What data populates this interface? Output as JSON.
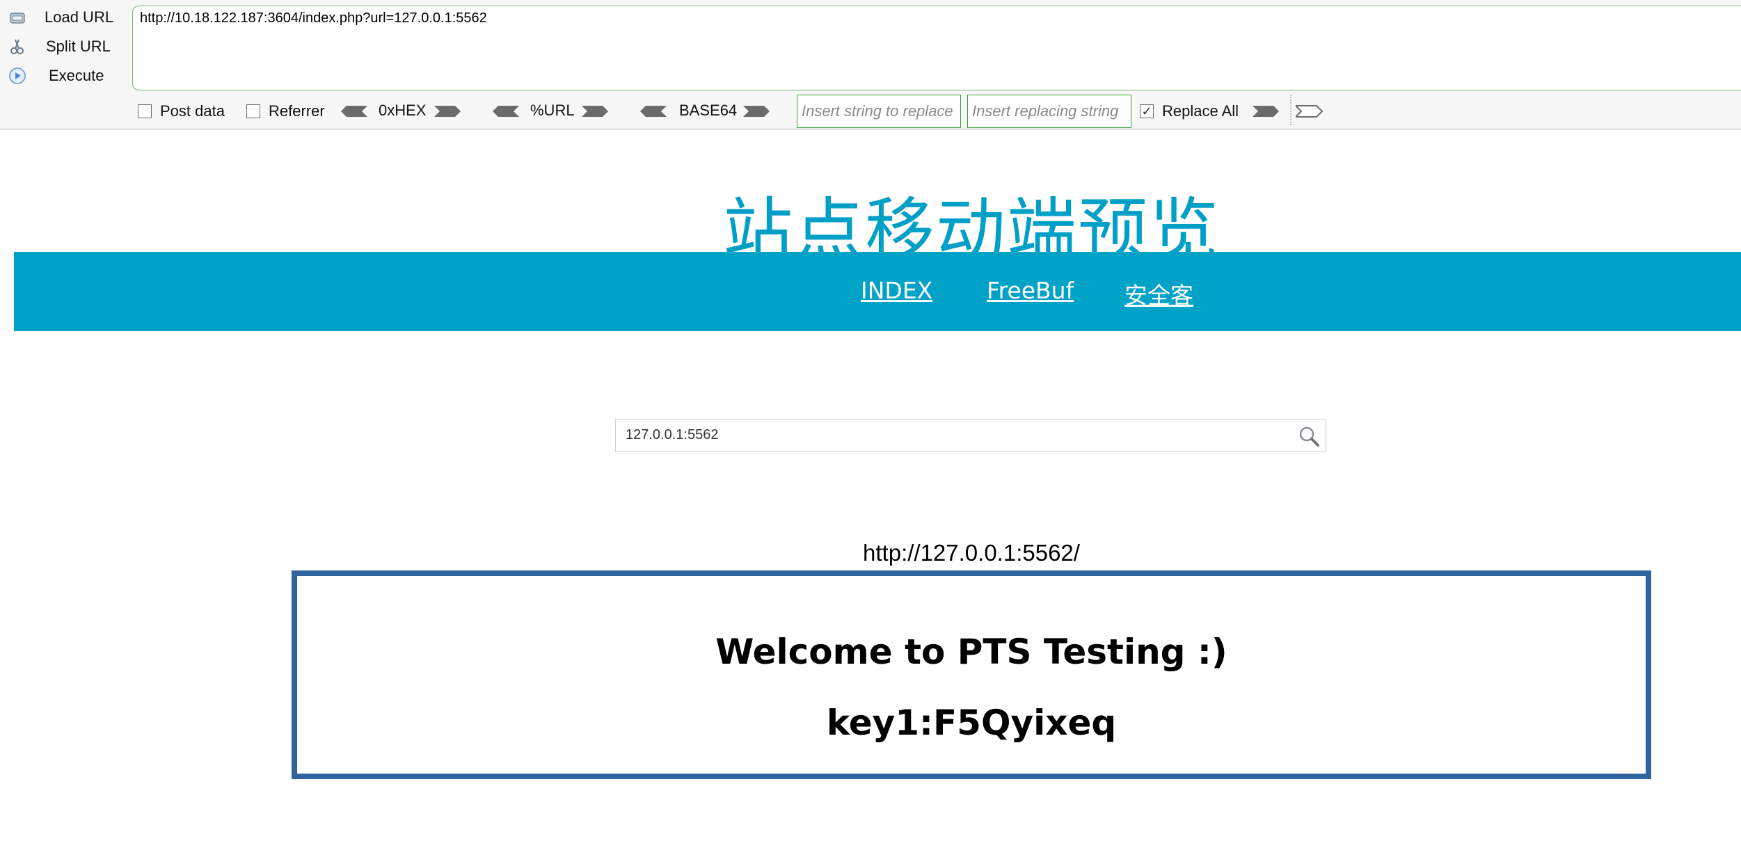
{
  "hackbar": {
    "load_url": "Load URL",
    "split_url": "Split URL",
    "execute": "Execute",
    "url_value": "http://10.18.122.187:3604/index.php?url=127.0.0.1:5562",
    "post_data": "Post data",
    "referrer": "Referrer",
    "hex": "0xHEX",
    "url_enc": "%URL",
    "base64": "BASE64",
    "replace_placeholder": "Insert string to replace",
    "replacing_placeholder": "Insert replacing string",
    "replace_all": "Replace All",
    "post_checked": false,
    "referrer_checked": false,
    "replace_all_checked": true
  },
  "page": {
    "site_title": "站点移动端预览",
    "nav": [
      "INDEX",
      "FreeBuf",
      "安全客"
    ],
    "search_value": "127.0.0.1:5562",
    "result_url": "http://127.0.0.1:5562/",
    "welcome": "Welcome to PTS Testing :)",
    "key": "key1:F5Qyixeq"
  },
  "colors": {
    "brand": "#00a2c8",
    "title": "#009fc7",
    "frame_border": "#2e64a0",
    "field_border": "#39a039"
  }
}
